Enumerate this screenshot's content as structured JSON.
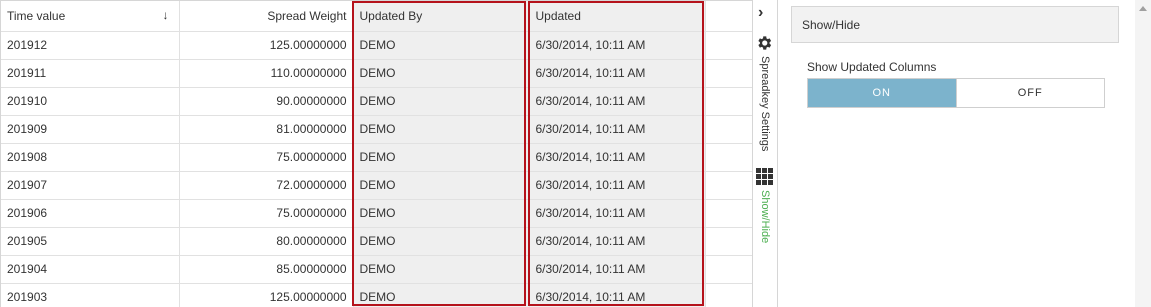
{
  "grid": {
    "columns": [
      {
        "label": "Time value"
      },
      {
        "label": "Spread Weight"
      },
      {
        "label": "Updated By"
      },
      {
        "label": "Updated"
      }
    ],
    "sort_icon": "↓",
    "rows": [
      {
        "time": "201912",
        "weight": "125.00000000",
        "by": "DEMO",
        "updated": "6/30/2014, 10:11 AM"
      },
      {
        "time": "201911",
        "weight": "110.00000000",
        "by": "DEMO",
        "updated": "6/30/2014, 10:11 AM"
      },
      {
        "time": "201910",
        "weight": "90.00000000",
        "by": "DEMO",
        "updated": "6/30/2014, 10:11 AM"
      },
      {
        "time": "201909",
        "weight": "81.00000000",
        "by": "DEMO",
        "updated": "6/30/2014, 10:11 AM"
      },
      {
        "time": "201908",
        "weight": "75.00000000",
        "by": "DEMO",
        "updated": "6/30/2014, 10:11 AM"
      },
      {
        "time": "201907",
        "weight": "72.00000000",
        "by": "DEMO",
        "updated": "6/30/2014, 10:11 AM"
      },
      {
        "time": "201906",
        "weight": "75.00000000",
        "by": "DEMO",
        "updated": "6/30/2014, 10:11 AM"
      },
      {
        "time": "201905",
        "weight": "80.00000000",
        "by": "DEMO",
        "updated": "6/30/2014, 10:11 AM"
      },
      {
        "time": "201904",
        "weight": "85.00000000",
        "by": "DEMO",
        "updated": "6/30/2014, 10:11 AM"
      },
      {
        "time": "201903",
        "weight": "125.00000000",
        "by": "DEMO",
        "updated": "6/30/2014, 10:11 AM"
      }
    ]
  },
  "strip": {
    "collapse_icon": "chevron-right-icon",
    "settings_label": "Spreadkey Settings",
    "showhide_label": "Show/Hide"
  },
  "panel": {
    "title": "Show/Hide",
    "option_label": "Show Updated Columns",
    "toggle_on": "ON",
    "toggle_off": "OFF",
    "selected": "ON"
  },
  "colors": {
    "highlight_border": "#b5121b",
    "toggle_active": "#7cb3cc",
    "showhide_text": "#4caf50"
  }
}
